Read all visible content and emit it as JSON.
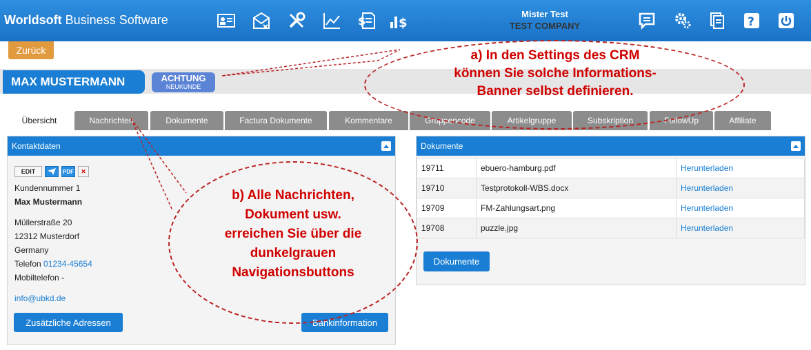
{
  "header": {
    "brand_bold": "Worldsoft",
    "brand_rest": " Business Software",
    "user_name": "Mister Test",
    "company": "TEST COMPANY"
  },
  "back_label": "Zurück",
  "customer": {
    "name": "MAX MUSTERMANN",
    "badge_title": "ACHTUNG",
    "badge_sub": "NEUKUNDE"
  },
  "tabs": [
    "Übersicht",
    "Nachrichten",
    "Dokumente",
    "Factura Dokumente",
    "Kommentare",
    "Gruppencode",
    "Artikelgruppe",
    "Subskription",
    "FollowUp",
    "Affiliate"
  ],
  "contact": {
    "title": "Kontaktdaten",
    "edit_label": "EDIT",
    "pdf_label": "PDF",
    "delete_label": "✕",
    "customer_number": "Kundennummer 1",
    "name": "Max Mustermann",
    "street": "Müllerstraße 20",
    "city": "12312 Musterdorf",
    "country": "Germany",
    "phone_label": "Telefon ",
    "phone": "01234-45654",
    "mobile": "Mobiltelefon -",
    "email": "info@ubkd.de",
    "extra_addresses_button": "Zusätzliche Adressen",
    "bank_button": "Bankinformation"
  },
  "documents": {
    "title": "Dokumente",
    "rows": [
      {
        "id": "19711",
        "file": "ebuero-hamburg.pdf",
        "action": "Herunterladen"
      },
      {
        "id": "19710",
        "file": "Testprotokoll-WBS.docx",
        "action": "Herunterladen"
      },
      {
        "id": "19709",
        "file": "FM-Zahlungsart.png",
        "action": "Herunterladen"
      },
      {
        "id": "19708",
        "file": "puzzle.jpg",
        "action": "Herunterladen"
      }
    ],
    "button": "Dokumente"
  },
  "annotations": {
    "a_line1": "a) In den Settings des CRM",
    "a_line2": "können Sie solche Informations-",
    "a_line3": "Banner selbst definieren.",
    "b_line1": "b) Alle Nachrichten,",
    "b_line2": "Dokument usw.",
    "b_line3": "erreichen Sie über die",
    "b_line4": "dunkelgrauen",
    "b_line5": "Navigationsbuttons"
  },
  "colors": {
    "header_blue": "#1a7fd4",
    "back_orange": "#e29a3f",
    "badge_blue": "#5c84d6",
    "tab_gray": "#8c8c8c",
    "annotation_red": "#d00000"
  },
  "icons": [
    "contact-card-icon",
    "mail-icon",
    "tools-icon",
    "chart-icon",
    "invoice-icon",
    "finance-icon",
    "chat-icon",
    "gears-icon",
    "documents-icon",
    "help-icon",
    "power-icon"
  ]
}
